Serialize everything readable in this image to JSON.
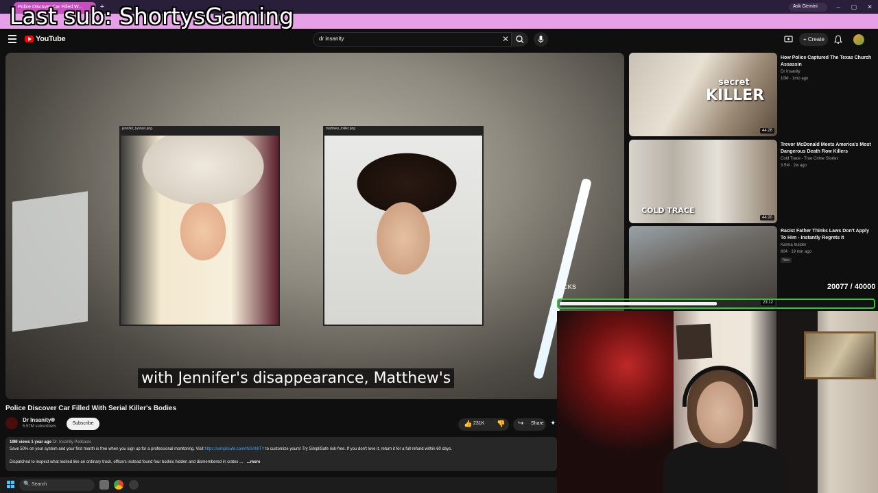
{
  "browser": {
    "tab_title": "Police Discover Car Filled W...",
    "tab_close": "×",
    "new_tab": "+",
    "ask_gemini": "Ask Gemini",
    "window_controls": {
      "minimize": "–",
      "maximize": "▢",
      "close": "✕"
    }
  },
  "stream_overlay": {
    "last_sub": "Last sub: ShortysGaming",
    "goal_label": "KICKS",
    "goal_count": "20077 / 40000",
    "goal_current": 20077,
    "goal_target": 40000
  },
  "youtube": {
    "wordmark": "YouTube",
    "search_query": "dr insanity",
    "search_clear": "✕",
    "create_label": "+ Create",
    "icons": [
      "menu-icon",
      "youtube-logo-icon",
      "search-icon",
      "mic-icon",
      "cast-icon",
      "bell-icon",
      "avatar"
    ]
  },
  "player": {
    "photo_left_title": "jennifer_lannon.png",
    "photo_right_title": "matthew_miller.png",
    "caption": "with Jennifer's disappearance, Matthew's"
  },
  "video": {
    "title": "Police Discover Car Filled With Serial Killer's Bodies",
    "channel": "Dr Insanity",
    "subscribers": "5.57M subscribers",
    "subscribe_label": "Subscribe",
    "likes": "231K",
    "share_label": "Share",
    "like_icon": "👍",
    "dislike_icon": "👎",
    "share_icon": "↪",
    "more_icon": "✦"
  },
  "description": {
    "views": "19M views",
    "age": "1 year ago",
    "playlist": "Dr. Insanity Podcasts",
    "line1_pre": "Save 50% on your system and your first month is free when you sign up for a professional monitoring. Visit",
    "link": "https://simplisafe.com/INSANITY",
    "line1_post": "to customize yours! Try SimpliSafe risk-free. If you don't love it, return it for a full refund within 60 days.",
    "line2": "Dispatched to inspect what looked like an ordinary truck, officers instead found four bodies hidden and dismembered in crates ...",
    "more": "...more"
  },
  "recommendations": [
    {
      "title": "How Police Captured The Texas Church Assassin",
      "channel": "Dr Insanity",
      "meta": "10M · 1mo ago",
      "duration": "44:26",
      "thumb_text_1": "secret",
      "thumb_text_2": "KILLER"
    },
    {
      "title": "Trevor McDonald Meets America's Most Dangerous Death Row Killers",
      "channel": "Cold Trace - True Crime Stories",
      "meta": "3.5M · 2w ago",
      "duration": "44:20",
      "thumb_text_1": "COLD TRACE"
    },
    {
      "title": "Racist Father Thinks Laws Don't Apply To Him - Instantly Regrets It",
      "channel": "Karma Insider",
      "meta": "804 · 19 min ago",
      "badge": "New",
      "duration": "23:12"
    }
  ],
  "taskbar": {
    "search_label": "Search",
    "search_icon": "🔍"
  },
  "colors": {
    "banner": "#e6a0e6",
    "youtube_red": "#ff0000",
    "goal_border": "#32c832",
    "link": "#3ea6ff"
  }
}
